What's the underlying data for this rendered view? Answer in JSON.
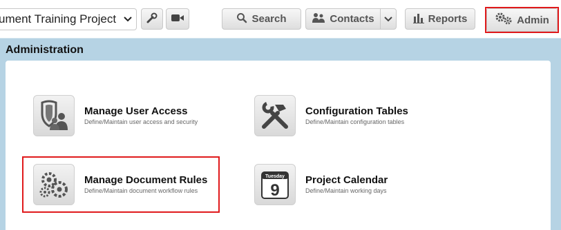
{
  "toolbar": {
    "project_select": "ument Training Project ...",
    "search_label": "Search",
    "contacts_label": "Contacts",
    "reports_label": "Reports",
    "admin_label": "Admin"
  },
  "section": {
    "title": "Administration"
  },
  "tiles": [
    {
      "title": "Manage User Access",
      "desc": "Define/Maintain user access and security",
      "icon": "shield-users-icon"
    },
    {
      "title": "Configuration Tables",
      "desc": "Define/Maintain configuration tables",
      "icon": "wrench-hammer-icon"
    },
    {
      "title": "Manage Document Rules",
      "desc": "Define/Maintain document workflow rules",
      "icon": "gears-icon"
    },
    {
      "title": "Project Calendar",
      "desc": "Define/Maintain working days",
      "icon": "calendar-icon",
      "calendar_day_name": "Tuesday",
      "calendar_day": "9"
    }
  ],
  "colors": {
    "highlight": "#e0191b",
    "background": "#b6d3e4"
  }
}
